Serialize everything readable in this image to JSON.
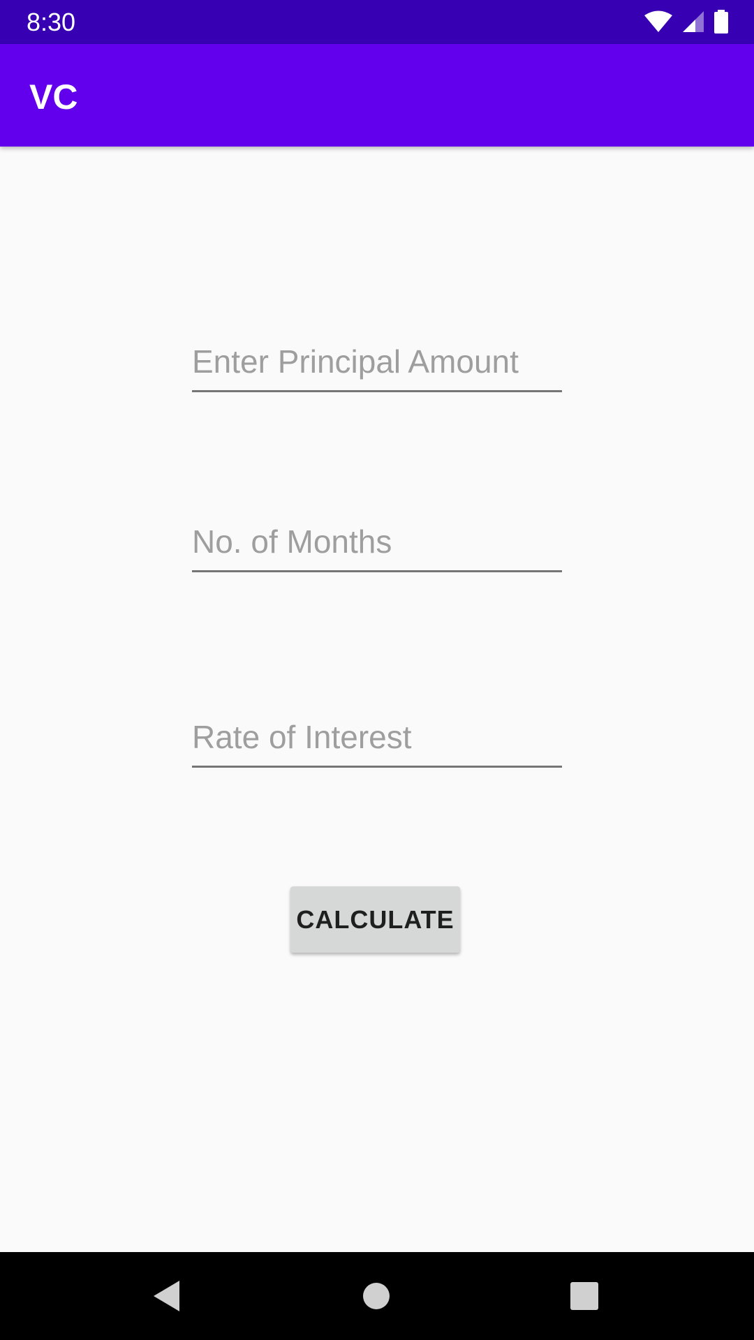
{
  "status_bar": {
    "time": "8:30",
    "icons": [
      "wifi-icon",
      "cellular-signal-icon",
      "battery-icon"
    ]
  },
  "app_bar": {
    "title": "VC"
  },
  "form": {
    "principal": {
      "value": "",
      "placeholder": "Enter Principal Amount"
    },
    "months": {
      "value": "",
      "placeholder": "No. of Months"
    },
    "rate": {
      "value": "",
      "placeholder": "Rate of Interest"
    },
    "calculate_label": "CALCULATE"
  },
  "nav_bar": {
    "buttons": [
      "back-icon",
      "home-icon",
      "recents-icon"
    ]
  },
  "colors": {
    "status_bar": "#3700b3",
    "app_bar": "#6200ee",
    "background": "#fafafa",
    "button": "#d6d7d7",
    "hint_text": "#9e9e9e"
  }
}
